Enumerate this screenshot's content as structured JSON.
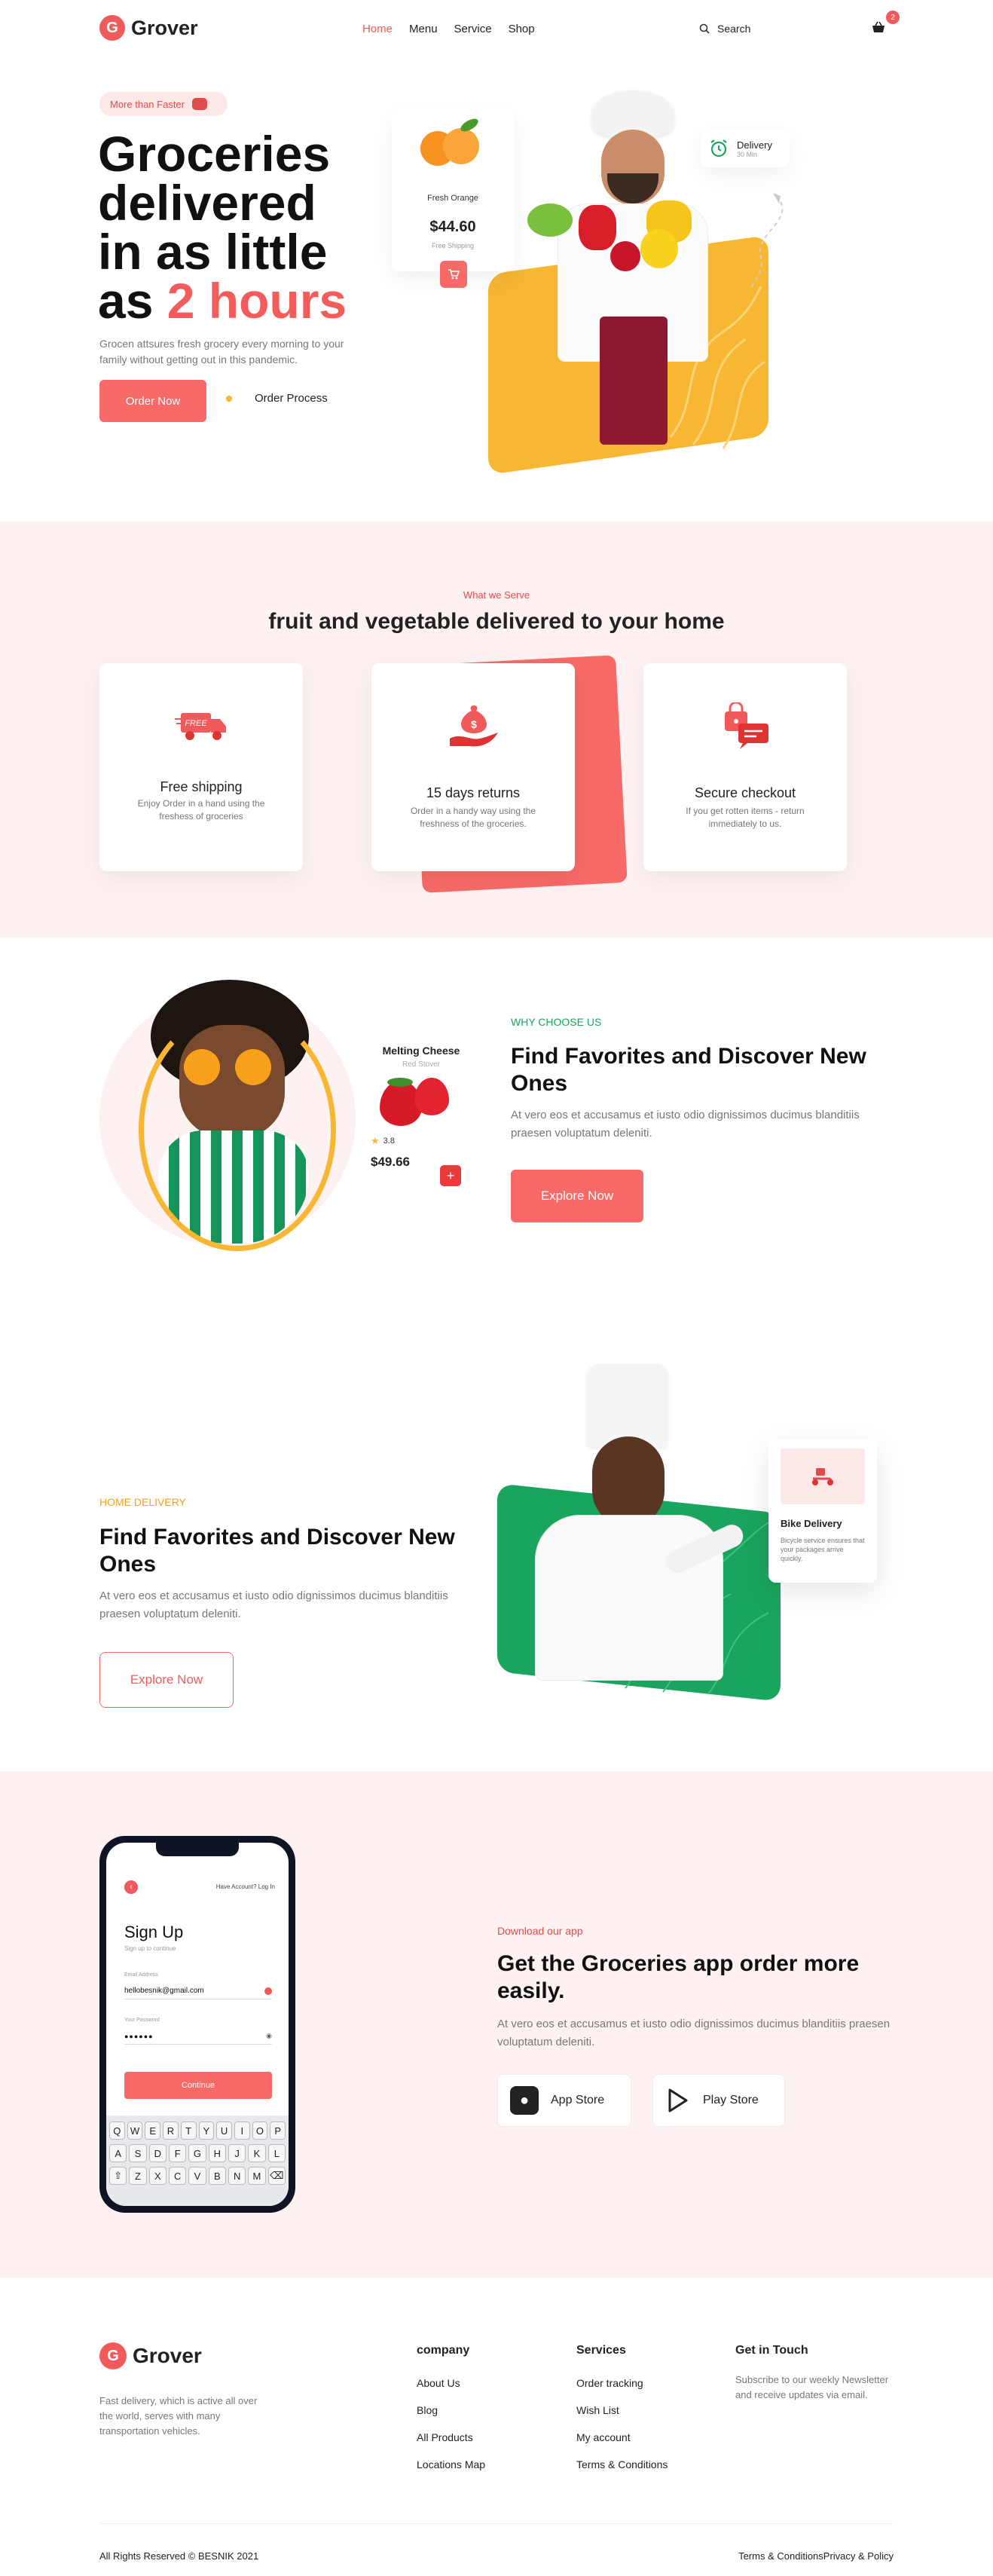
{
  "header": {
    "brand": "Grover",
    "nav": [
      "Home",
      "Menu",
      "Service",
      "Shop"
    ],
    "search_label": "Search",
    "cart_count": "2"
  },
  "hero": {
    "badge": "More than Faster",
    "title_line1": "Groceries",
    "title_line2": "delivered",
    "title_line3": "in as little",
    "title_line4_prefix": "as ",
    "title_highlight": "2 hours",
    "description": "Grocen attsures fresh grocery every morning to your family without getting out in this pandemic.",
    "order_button": "Order Now",
    "process_button": "Order Process",
    "product_card": {
      "name": "Fresh Orange",
      "price": "$44.60",
      "shipping": "Free Shipping"
    },
    "delivery_card": {
      "title": "Delivery",
      "time": "30 Min"
    }
  },
  "serve": {
    "eyebrow": "What we Serve",
    "title": "fruit and vegetable delivered to your home",
    "cards": [
      {
        "title": "Free shipping",
        "text": "Enjoy Order in a hand using the freshess of groceries",
        "icon": "delivery-truck-icon"
      },
      {
        "title": "15 days returns",
        "text": "Order in a handy way using the freshness of the groceries.",
        "icon": "money-hand-icon"
      },
      {
        "title": "Secure checkout",
        "text": "If you get rotten items - return immediately to us.",
        "icon": "secure-chat-icon"
      }
    ]
  },
  "why": {
    "eyebrow": "WHY CHOOSE US",
    "title": "Find Favorites and Discover New Ones",
    "description": "At vero eos et accusamus et iusto odio dignissimos ducimus blanditiis praesen voluptatum deleniti.",
    "button": "Explore Now",
    "product": {
      "name": "Melting Cheese",
      "sub": "Red Stover",
      "rating": "3.8",
      "price": "$49.66"
    }
  },
  "home_delivery": {
    "eyebrow": "HOME DELIVERY",
    "title": "Find Favorites and Discover New Ones",
    "description": "At vero eos et accusamus et iusto odio dignissimos ducimus blanditiis praesen voluptatum deleniti.",
    "button": "Explore Now",
    "bike_card": {
      "title": "Bike Delivery",
      "text": "Bicycle service ensures that your packages arrive quickly."
    }
  },
  "app": {
    "eyebrow": "Download our app",
    "title": "Get the Groceries app order more easily.",
    "description": "At vero eos et accusamus et iusto odio dignissimos ducimus blanditiis praesen voluptatum deleniti.",
    "app_store": "App Store",
    "play_store": "Play Store",
    "phone": {
      "top_link": "Have Account? Log In",
      "title": "Sign Up",
      "subtitle": "Sign up to continue",
      "email_label": "Email Address",
      "email_value": "hellobesnik@gmail.com",
      "password_label": "Your Password",
      "password_value": "●●●●●●",
      "continue": "Continue",
      "keys_row1": [
        "Q",
        "W",
        "E",
        "R",
        "T",
        "Y",
        "U",
        "I",
        "O",
        "P"
      ],
      "keys_row2": [
        "A",
        "S",
        "D",
        "F",
        "G",
        "H",
        "J",
        "K",
        "L"
      ],
      "keys_row3": [
        "Z",
        "X",
        "C",
        "V",
        "B",
        "N",
        "M"
      ]
    }
  },
  "footer": {
    "brand": "Grover",
    "about": "Fast delivery, which is active all over the world, serves with many transportation vehicles.",
    "col1_title": "company",
    "col1": [
      "About Us",
      "Blog",
      "All Products",
      "Locations Map"
    ],
    "col2_title": "Services",
    "col2": [
      "Order tracking",
      "Wish List",
      "My account",
      "Terms & Conditions"
    ],
    "col3_title": "Get in Touch",
    "col3_text": "Subscribe to our weekly Newsletter and receive updates via email.",
    "copyright": "All Rights Reserved © BESNIK 2021",
    "terms": "Terms & Conditions",
    "privacy": "Privacy & Policy"
  },
  "colors": {
    "accent": "#f76a68",
    "green": "#1aa55e",
    "yellow": "#f7b733",
    "blush": "#fdf2f1"
  }
}
